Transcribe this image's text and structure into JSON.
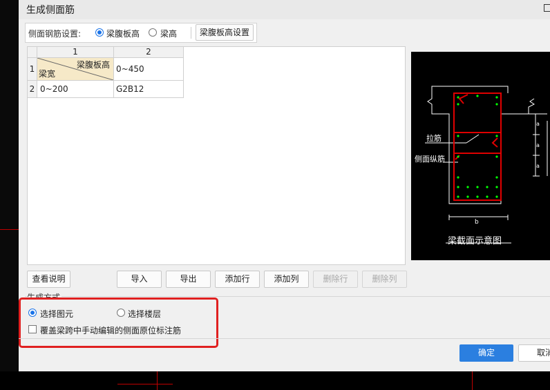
{
  "dialog": {
    "title": "生成侧面筋"
  },
  "settings": {
    "label": "侧面钢筋设置:",
    "option_web_height": "梁腹板高",
    "option_beam_height": "梁高",
    "selected": "梁腹板高",
    "config_button": "梁腹板高设置"
  },
  "table": {
    "col_headers": [
      "1",
      "2"
    ],
    "row_headers": [
      "1",
      "2"
    ],
    "diag_top": "梁腹板高",
    "diag_bottom": "梁宽",
    "r1c2": "0~450",
    "r2c1": "0~200",
    "r2c2": "G2B12"
  },
  "diagram": {
    "tie_label": "拉筋",
    "side_bar_label": "侧面纵筋",
    "width_label": "b",
    "spacing_label": "a",
    "caption": "梁截面示意图"
  },
  "buttons": {
    "help": "查看说明",
    "import": "导入",
    "export": "导出",
    "add_row": "添加行",
    "add_col": "添加列",
    "del_row": "删除行",
    "del_col": "删除列",
    "ok": "确定",
    "cancel": "取消"
  },
  "generation": {
    "label": "生成方式",
    "option_element": "选择图元",
    "option_floor": "选择楼层",
    "selected": "选择图元",
    "override_checkbox": "覆盖梁跨中手动编辑的侧面原位标注筋",
    "override_checked": false
  },
  "colors": {
    "accent": "#2b7fe0",
    "highlight": "#e02020",
    "rebar": "#e00000",
    "stirrup_dot": "#00ff00"
  }
}
